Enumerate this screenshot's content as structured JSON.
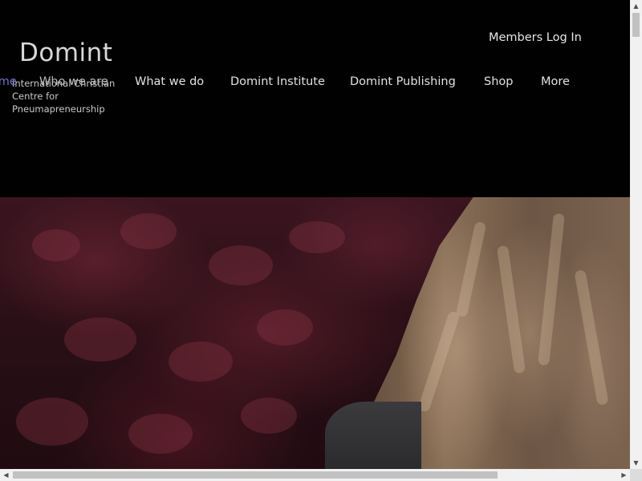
{
  "brand": {
    "name": "Domint",
    "tagline": "International Christian Centre for Pneumapreneurship"
  },
  "header": {
    "members_login": "Members Log In"
  },
  "nav": {
    "items": [
      {
        "label": "Home"
      },
      {
        "label": "Who we are"
      },
      {
        "label": "What we do"
      },
      {
        "label": "Domint Institute"
      },
      {
        "label": "Domint Publishing"
      },
      {
        "label": "Shop"
      },
      {
        "label": "More"
      }
    ]
  },
  "icons": {
    "scroll_up": "chevron-up-icon",
    "scroll_down": "chevron-down-icon",
    "scroll_left": "chevron-left-icon",
    "scroll_right": "chevron-right-icon"
  },
  "colors": {
    "header_bg": "#010101",
    "nav_active": "#6f72c8",
    "nav_text": "#e2e2e2"
  }
}
